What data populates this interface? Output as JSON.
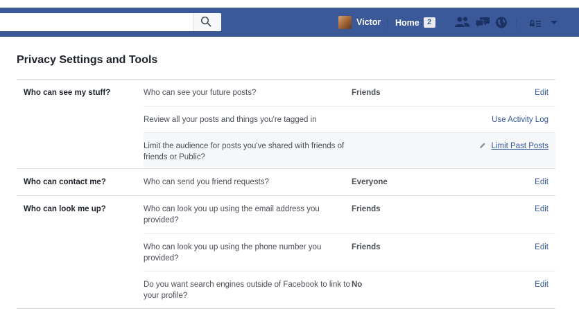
{
  "topbar": {
    "search_placeholder": "",
    "profile_name": "Victor",
    "home_label": "Home",
    "home_count": "2",
    "icons": [
      "friend-requests-icon",
      "messages-icon",
      "notifications-globe-icon",
      "privacy-shortcuts-icon",
      "account-menu-caret-icon"
    ]
  },
  "page": {
    "title": "Privacy Settings and Tools"
  },
  "sections": [
    {
      "title": "Who can see my stuff?",
      "rows": [
        {
          "question": "Who can see your future posts?",
          "value": "Friends",
          "action": "Edit"
        },
        {
          "question": "Review all your posts and things you're tagged in",
          "value": "",
          "action": "Use Activity Log"
        },
        {
          "question": "Limit the audience for posts you've shared with friends of friends or Public?",
          "value": "",
          "action": "Limit Past Posts"
        }
      ]
    },
    {
      "title": "Who can contact me?",
      "rows": [
        {
          "question": "Who can send you friend requests?",
          "value": "Everyone",
          "action": "Edit"
        }
      ]
    },
    {
      "title": "Who can look me up?",
      "rows": [
        {
          "question": "Who can look you up using the email address you provided?",
          "value": "Friends",
          "action": "Edit"
        },
        {
          "question": "Who can look you up using the phone number you provided?",
          "value": "Friends",
          "action": "Edit"
        },
        {
          "question": "Do you want search engines outside of Facebook to link to your profile?",
          "value": "No",
          "action": "Edit"
        }
      ]
    }
  ],
  "colors": {
    "topbar": "#3b5998",
    "link": "#365899",
    "highlight_row": "#f6f7f9"
  }
}
